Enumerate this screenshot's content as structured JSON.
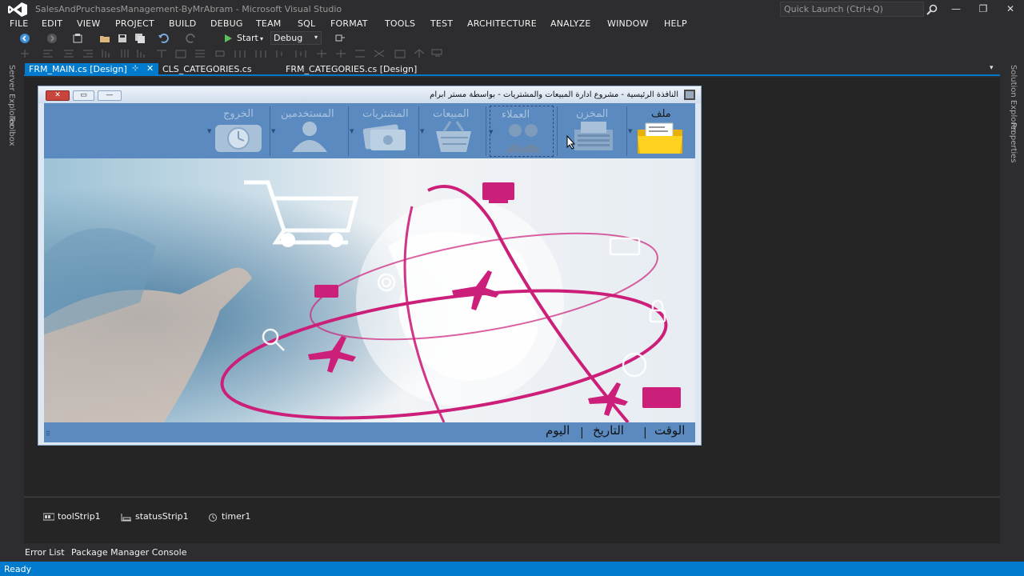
{
  "window": {
    "title": "SalesAndPruchasesManagement-ByMrAbram - Microsoft Visual Studio",
    "quick_launch_placeholder": "Quick Launch (Ctrl+Q)",
    "minimize": "—",
    "restore": "❐",
    "close": "✕"
  },
  "menu": {
    "items": [
      "FILE",
      "EDIT",
      "VIEW",
      "PROJECT",
      "BUILD",
      "DEBUG",
      "TEAM",
      "SQL",
      "FORMAT",
      "TOOLS",
      "TEST",
      "ARCHITECTURE",
      "ANALYZE",
      "WINDOW",
      "HELP"
    ]
  },
  "toolbar": {
    "start_label": "Start",
    "config_label": "Debug"
  },
  "side_panels": {
    "left": [
      "Server Explorer",
      "Toolbox"
    ],
    "right": [
      "Solution Explorer",
      "Properties"
    ]
  },
  "tabs": [
    {
      "label": "FRM_MAIN.cs [Design]",
      "active": true
    },
    {
      "label": "CLS_CATEGORIES.cs",
      "active": false
    },
    {
      "label": "FRM_CATEGORIES.cs [Design]",
      "active": false
    }
  ],
  "form": {
    "title": "النافذة الرئيسية - مشروع ادارة المبيعات والمشتريات - بواسطة مستر ابرام",
    "toolstrip": {
      "file_label": "ملف",
      "items": [
        {
          "label": "ملف",
          "icon": "folder-icon",
          "enabled": true
        },
        {
          "label": "المخزن",
          "icon": "printer-icon",
          "enabled": false
        },
        {
          "label": "العملاء",
          "icon": "users-icon",
          "enabled": false
        },
        {
          "label": "المبيعات",
          "icon": "basket-icon",
          "enabled": false
        },
        {
          "label": "المشتريات",
          "icon": "money-icon",
          "enabled": false
        },
        {
          "label": "المستخدمين",
          "icon": "person-icon",
          "enabled": false
        },
        {
          "label": "الخروج",
          "icon": "clock-icon",
          "enabled": false
        }
      ]
    },
    "statusstrip": {
      "time_label": "الوقت",
      "date_label": "التاريخ",
      "day_label": "اليوم",
      "separator": "|"
    }
  },
  "component_tray": {
    "items": [
      {
        "label": "toolStrip1",
        "icon": "toolstrip-icon"
      },
      {
        "label": "statusStrip1",
        "icon": "statusstrip-icon"
      },
      {
        "label": "timer1",
        "icon": "timer-icon"
      }
    ]
  },
  "bottom_tabs": [
    "Error List",
    "Package Manager Console"
  ],
  "status": {
    "text": "Ready"
  },
  "colors": {
    "vs_background": "#2d2d30",
    "accent": "#007acc",
    "form_strip": "#5a8ac0",
    "form_close": "#c9443c"
  }
}
